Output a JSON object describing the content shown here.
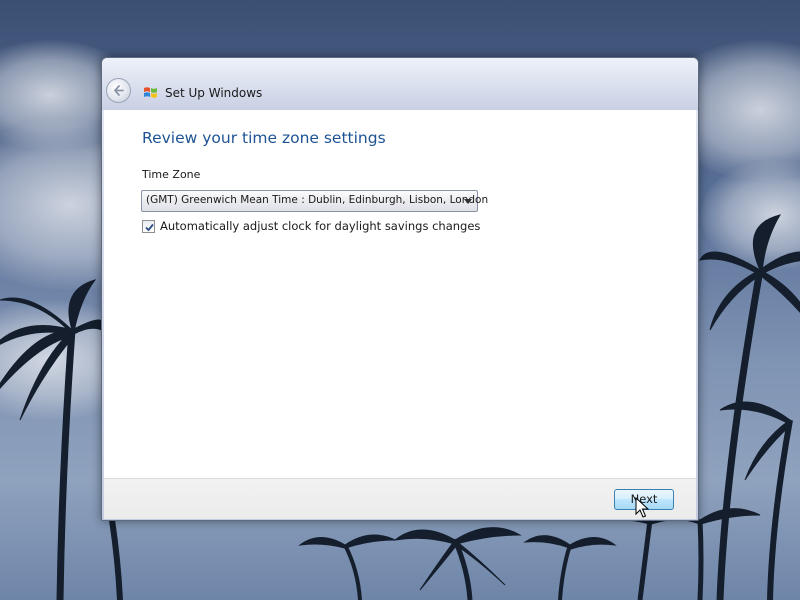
{
  "window": {
    "title": "Set Up Windows",
    "logo_icon": "windows-flag-icon",
    "back_icon": "back-arrow-icon"
  },
  "page": {
    "heading": "Review your time zone settings",
    "time_zone_label": "Time Zone",
    "time_zone_value": "(GMT) Greenwich Mean Time : Dublin, Edinburgh, Lisbon, London",
    "dst_checkbox_label": "Automatically adjust clock for daylight savings changes",
    "dst_checked": true
  },
  "footer": {
    "next_label": "Next"
  },
  "colors": {
    "heading": "#1e5393",
    "next_button_border": "#3c7fb1",
    "checkmark": "#2b4d82"
  }
}
